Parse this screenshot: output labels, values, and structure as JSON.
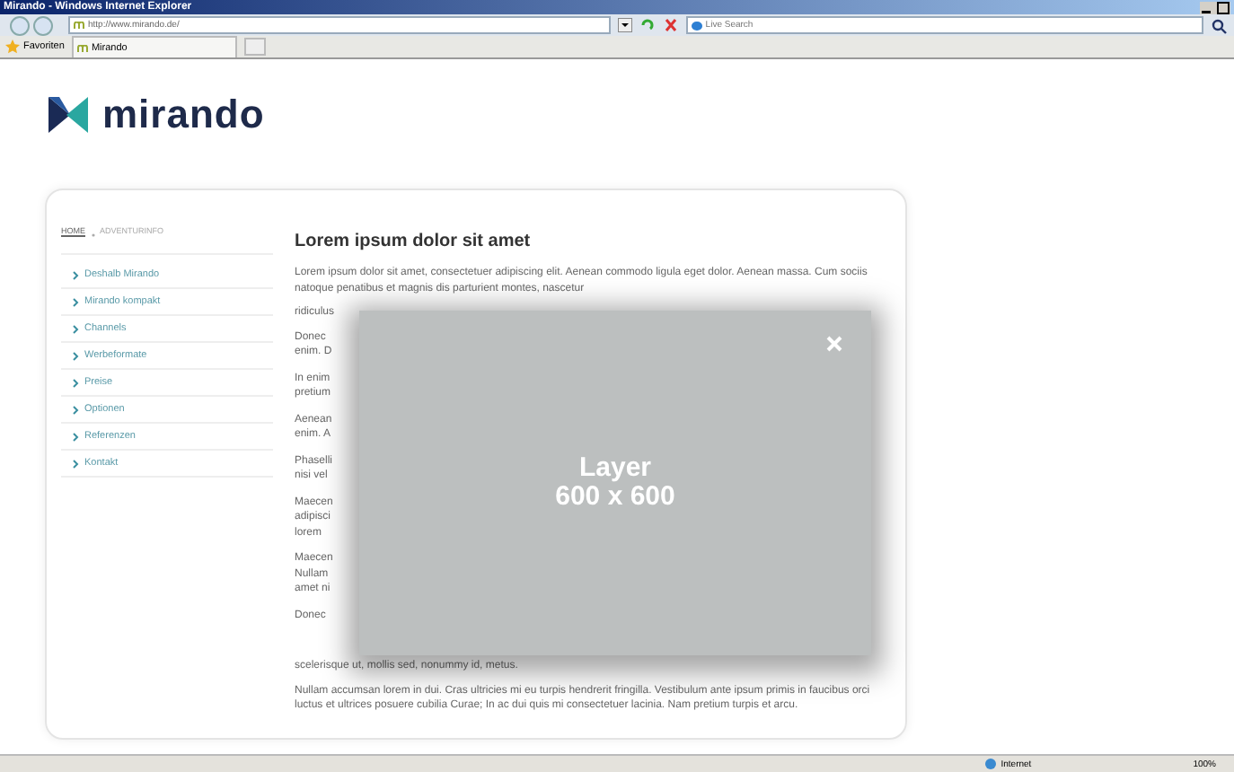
{
  "window": {
    "title": "Mirando - Windows Internet Explorer"
  },
  "address_bar": {
    "value": "http://www.mirando.de/"
  },
  "search": {
    "placeholder": "Live Search"
  },
  "favorites_bar": {
    "favorites_label": "Favoriten",
    "tabs": [
      {
        "label": "Mirando",
        "selected": true
      }
    ]
  },
  "logo": {
    "text": "mirando"
  },
  "breadcrumb": [
    {
      "label": "HOME"
    },
    {
      "label": "ADVENTURINFO"
    }
  ],
  "nav": [
    {
      "label": "Deshalb Mirando"
    },
    {
      "label": "Mirando kompakt"
    },
    {
      "label": "Channels"
    },
    {
      "label": "Werbeformate"
    },
    {
      "label": "Preise"
    },
    {
      "label": "Optionen"
    },
    {
      "label": "Referenzen"
    },
    {
      "label": "Kontakt"
    }
  ],
  "article": {
    "heading": "Lorem ipsum dolor sit amet",
    "intro": "Lorem ipsum dolor sit amet, consectetuer adipiscing elit. Aenean commodo ligula eget dolor. Aenean massa. Cum sociis natoque penatibus et magnis dis parturient montes, nascetur",
    "intro_cut": "ridiculus",
    "fragments": [
      [
        "Donec",
        "enim. D"
      ],
      [
        "In enim",
        "pretium"
      ],
      [
        "Aenean",
        "enim. A"
      ],
      [
        "Phaselli",
        "nisi vel"
      ],
      [
        "Maecen",
        "adipisci",
        "lorem"
      ],
      [
        "Maecen",
        "Nullam",
        "amet ni"
      ],
      [
        "Donec"
      ]
    ],
    "tail": "scelerisque ut, mollis sed, nonummy id, metus.",
    "last": "Nullam accumsan lorem in dui. Cras ultricies mi eu turpis hendrerit fringilla. Vestibulum ante ipsum primis in faucibus orci luctus et ultrices posuere cubilia Curae; In ac dui quis mi consectetuer lacinia. Nam pretium turpis et arcu."
  },
  "layer": {
    "title": "Layer",
    "size": "600  x 600"
  },
  "status_bar": {
    "zone": "Internet",
    "zoom": "100%"
  }
}
